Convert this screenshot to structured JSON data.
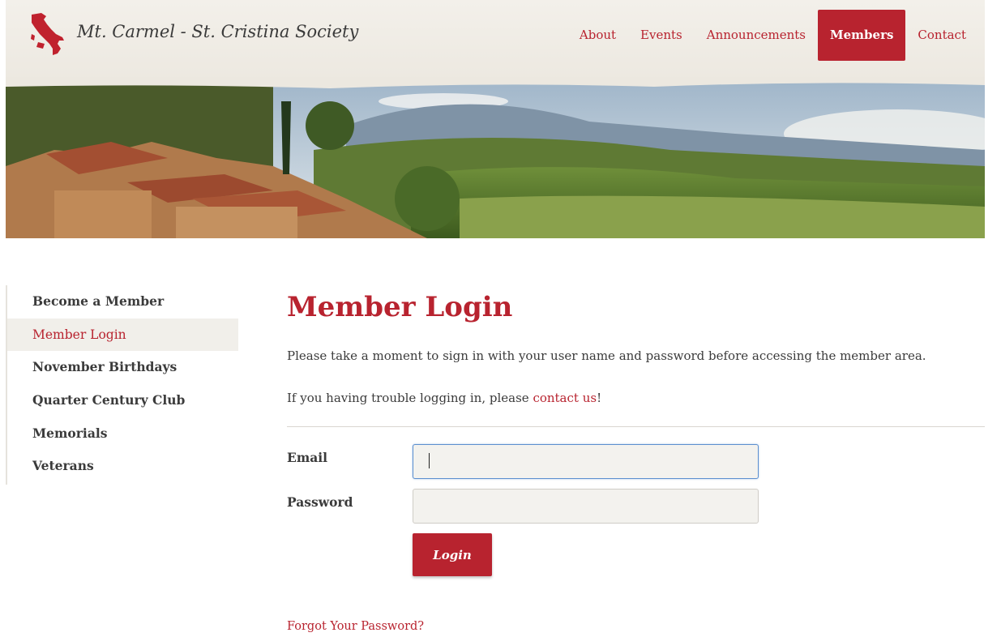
{
  "site": {
    "title": "Mt. Carmel - St. Cristina Society",
    "logo_icon": "italy-map-icon"
  },
  "nav": {
    "items": [
      {
        "label": "About",
        "active": false
      },
      {
        "label": "Events",
        "active": false
      },
      {
        "label": "Announcements",
        "active": false
      },
      {
        "label": "Members",
        "active": true
      },
      {
        "label": "Contact",
        "active": false
      }
    ]
  },
  "sidebar": {
    "items": [
      {
        "label": "Become a Member",
        "active": false
      },
      {
        "label": "Member Login",
        "active": true
      },
      {
        "label": "November Birthdays",
        "active": false
      },
      {
        "label": "Quarter Century Club",
        "active": false
      },
      {
        "label": "Memorials",
        "active": false
      },
      {
        "label": "Veterans",
        "active": false
      }
    ]
  },
  "main": {
    "title": "Member Login",
    "intro": "Please take a moment to sign in with your user name and password before accessing the member area.",
    "trouble_prefix": "If you having trouble logging in, please ",
    "trouble_link": "contact us",
    "trouble_suffix": "!",
    "form": {
      "email_label": "Email",
      "email_value": "",
      "password_label": "Password",
      "password_value": "",
      "login_label": "Login"
    },
    "forgot_label": "Forgot Your Password?"
  },
  "colors": {
    "accent": "#b8232f",
    "header_bg": "#f3f0ea",
    "sidebar_active_bg": "#f1efea",
    "focus_border": "#5b8fcf"
  }
}
